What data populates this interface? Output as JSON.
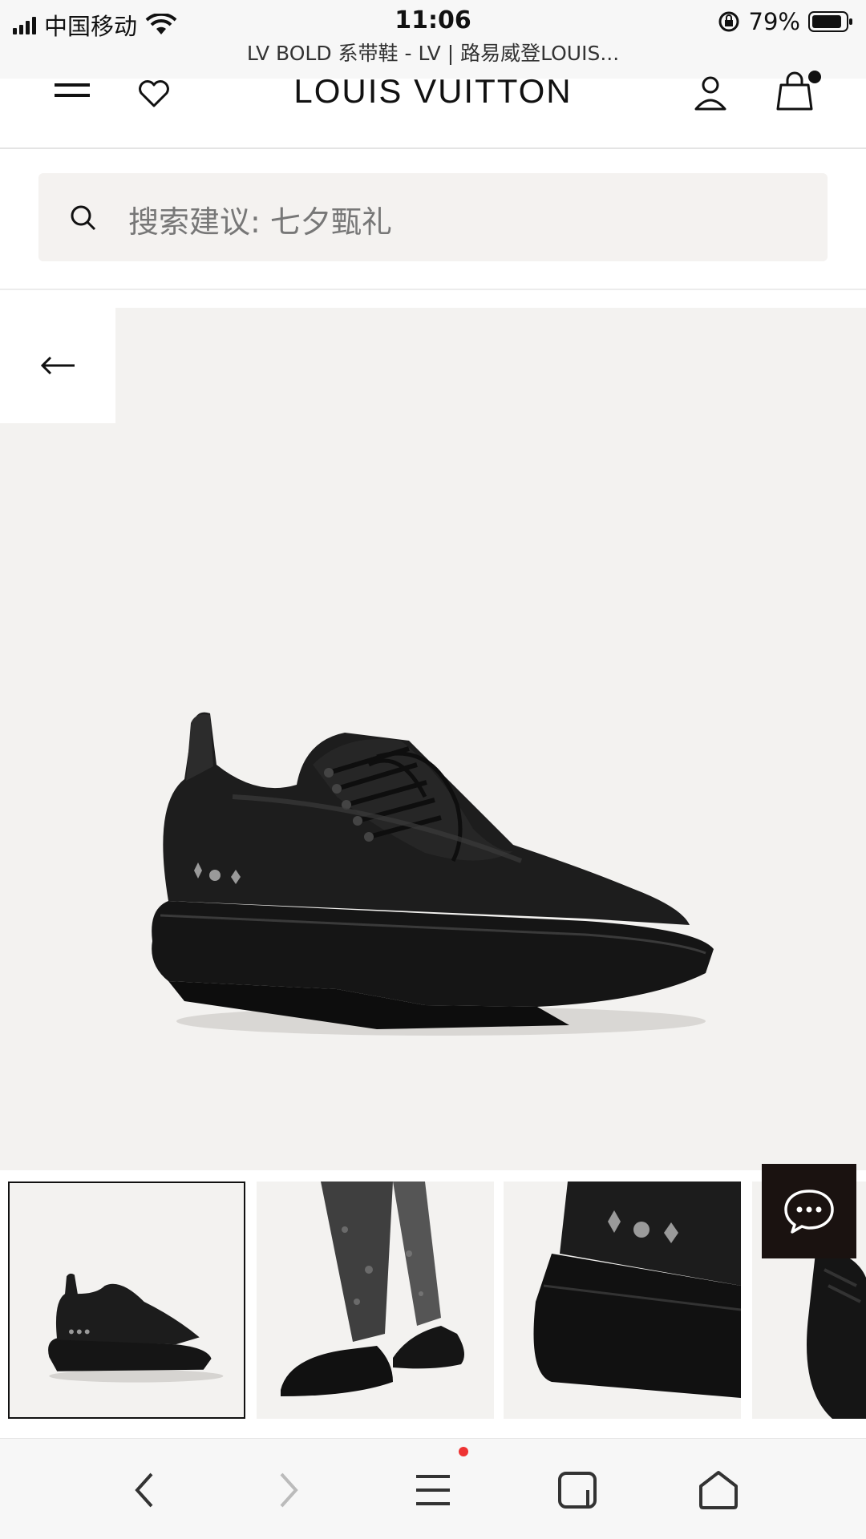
{
  "status_bar": {
    "carrier": "中国移动",
    "time": "11:06",
    "battery": "79%"
  },
  "browser": {
    "page_title": "LV BOLD 系带鞋 - LV | 路易威登LOUIS..."
  },
  "header": {
    "logo": "LOUIS VUITTON"
  },
  "search": {
    "placeholder": "搜索建议: 七夕甄礼"
  },
  "gallery": {
    "thumbnail_count": 4,
    "selected_index": 0
  },
  "colors": {
    "accent_dark": "#1a1210",
    "image_bg": "#f3f2f0",
    "notification": "#ee3333"
  }
}
